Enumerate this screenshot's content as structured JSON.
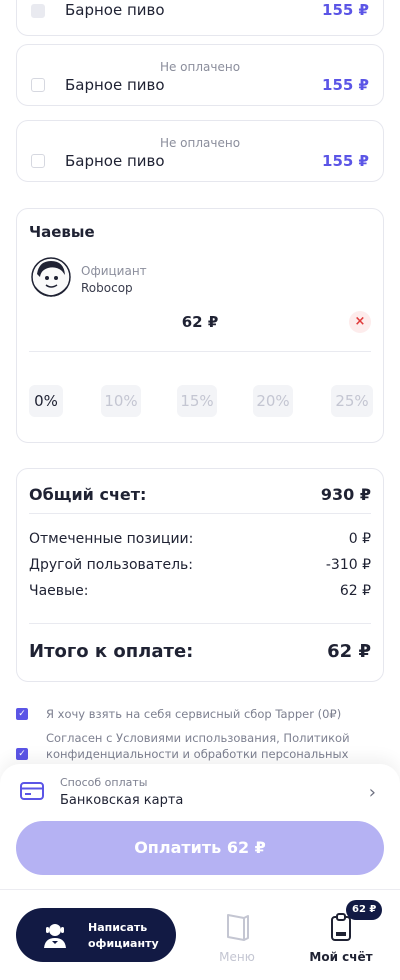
{
  "items": [
    {
      "status": "",
      "name": "Барное пиво",
      "price": "155 ₽"
    },
    {
      "status": "Не оплачено",
      "name": "Барное пиво",
      "price": "155 ₽"
    },
    {
      "status": "Не оплачено",
      "name": "Барное пиво",
      "price": "155 ₽"
    }
  ],
  "tips": {
    "title": "Чаевые",
    "waiter_role": "Официант",
    "waiter_name": "Robocop",
    "amount": "62 ₽",
    "clear_symbol": "×",
    "percents": [
      "0%",
      "10%",
      "15%",
      "20%",
      "25%"
    ],
    "selected_percent": "0%"
  },
  "summary": {
    "total_label": "Общий счет:",
    "total_value": "930 ₽",
    "rows": [
      {
        "label": "Отмеченные позиции:",
        "value": "0 ₽"
      },
      {
        "label": "Другой пользователь:",
        "value": "-310 ₽"
      },
      {
        "label": "Чаевые:",
        "value": "62 ₽"
      }
    ],
    "to_pay_label": "Итого к оплате:",
    "to_pay_value": "62 ₽"
  },
  "agreements": {
    "service_fee": "Я хочу взять на себя сервисный сбор Tapper (0₽)",
    "terms": "Согласен с Условиями использования, Политикой конфиденциальности и обработки персональных данных",
    "service_fee_checked": true,
    "terms_checked": true
  },
  "payment": {
    "method_label": "Способ оплаты",
    "method_value": "Банковская карта",
    "pay_button": "Оплатить 62 ₽"
  },
  "nav": {
    "call_waiter": "Написать официанту",
    "call_waiter_line1": "Написать",
    "call_waiter_line2": "официанту",
    "menu": "Меню",
    "my_bill": "Мой счёт",
    "bill_badge": "62 ₽"
  },
  "colors": {
    "accent": "#5b55e6",
    "dark": "#121a44",
    "pay_button": "#b5b2f3"
  },
  "icons": [
    "card-icon",
    "chevron-right-icon",
    "waiter-icon",
    "menu-book-icon",
    "bill-icon",
    "close-icon",
    "check-icon"
  ]
}
